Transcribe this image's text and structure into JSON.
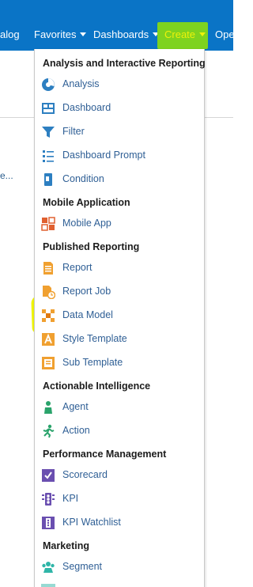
{
  "nav": {
    "items": [
      {
        "label": "alog"
      },
      {
        "label": "Favorites"
      },
      {
        "label": "Dashboards"
      },
      {
        "label": "Create"
      },
      {
        "label": "Ope"
      }
    ]
  },
  "background": {
    "truncated_text": "e..."
  },
  "menu": {
    "sections": {
      "analysis": "Analysis and Interactive Reporting",
      "mobile": "Mobile Application",
      "published": "Published Reporting",
      "actionable": "Actionable Intelligence",
      "performance": "Performance Management",
      "marketing": "Marketing"
    },
    "items": {
      "analysis": "Analysis",
      "dashboard": "Dashboard",
      "filter": "Filter",
      "dashboard_prompt": "Dashboard Prompt",
      "condition": "Condition",
      "mobile_app": "Mobile App",
      "report": "Report",
      "report_job": "Report Job",
      "data_model": "Data Model",
      "style_template": "Style Template",
      "sub_template": "Sub Template",
      "agent": "Agent",
      "action": "Action",
      "scorecard": "Scorecard",
      "kpi": "KPI",
      "kpi_watchlist": "KPI Watchlist",
      "segment": "Segment"
    }
  },
  "colors": {
    "nav_background": "#0a74c6",
    "create_highlight": "#7ed31f",
    "annotation_yellow": "#f0f50a",
    "menu_link": "#2f5f95"
  },
  "icons": {
    "analysis": "pie-chart-icon",
    "dashboard": "dashboard-grid-icon",
    "filter": "funnel-icon",
    "dashboard_prompt": "prompt-list-icon",
    "condition": "condition-icon",
    "mobile_app": "mobile-app-icon",
    "report": "report-document-icon",
    "report_job": "scheduled-report-icon",
    "data_model": "data-model-icon",
    "style_template": "style-template-icon",
    "sub_template": "sub-template-icon",
    "agent": "agent-person-icon",
    "action": "action-runner-icon",
    "scorecard": "scorecard-icon",
    "kpi": "kpi-icon",
    "kpi_watchlist": "kpi-watchlist-icon",
    "segment": "segment-group-icon"
  }
}
